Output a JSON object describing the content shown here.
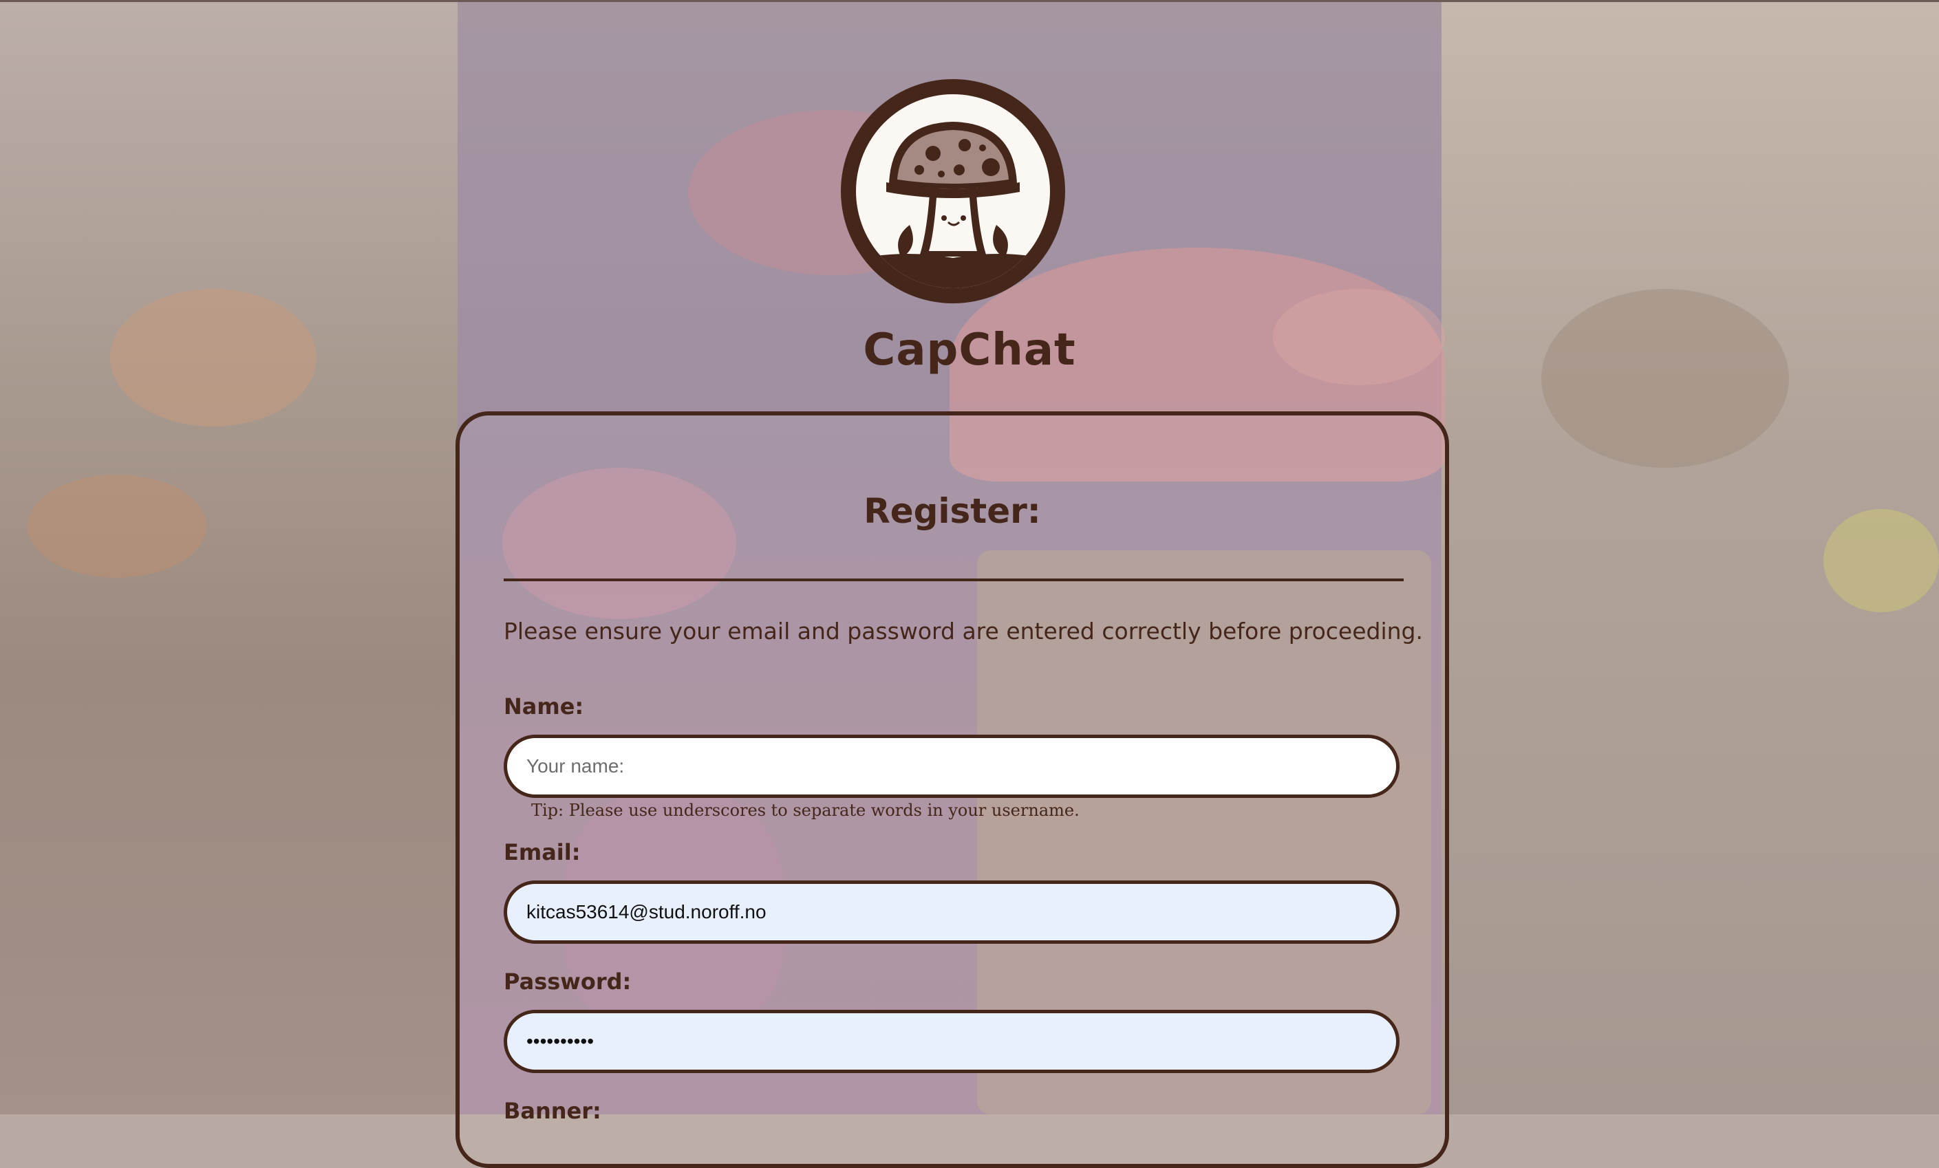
{
  "app": {
    "title": "CapChat"
  },
  "logo": {
    "icon": "mushroom-icon"
  },
  "register": {
    "title": "Register:",
    "notice": "Please ensure your email and password are entered correctly before proceeding.",
    "name": {
      "label": "Name:",
      "placeholder": "Your name:",
      "value": "",
      "tip": "Tip: Please use underscores to separate words in your username."
    },
    "email": {
      "label": "Email:",
      "value": "kitcas53614@stud.noroff.no"
    },
    "password": {
      "label": "Password:",
      "value": "••••••••••"
    },
    "banner": {
      "label": "Banner:"
    }
  },
  "colors": {
    "brand": "#45261a",
    "input_bg": "#ffffff",
    "autofill_bg": "#e8effd"
  }
}
